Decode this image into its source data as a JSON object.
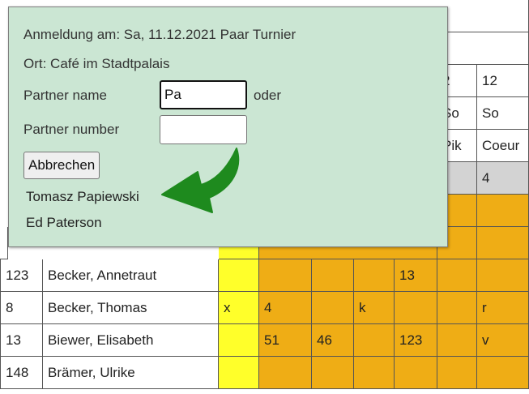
{
  "dialog": {
    "title": "Anmeldung am: Sa, 11.12.2021 Paar Turnier",
    "location": "Ort: Café im Stadtpalais",
    "partner_name_label": "Partner name",
    "partner_name_value": "Pa",
    "or_label": "oder",
    "partner_number_label": "Partner number",
    "partner_number_value": "",
    "cancel_button": "Abbrechen",
    "suggestions": [
      "Tomasz Papiewski",
      "Ed Paterson"
    ]
  },
  "header_fragments": {
    "row1": [
      "2",
      "12"
    ],
    "row2": [
      "So",
      "So"
    ],
    "row3": [
      "Pik",
      "Coeur"
    ],
    "row4": [
      "4"
    ]
  },
  "table_rows": [
    {
      "num": "123",
      "name": "Becker, Annetraut",
      "c1": "",
      "c2": "",
      "c3": "",
      "c4": "",
      "c5": "13",
      "c6": "",
      "c7": ""
    },
    {
      "num": "8",
      "name": "Becker, Thomas",
      "c1": "x",
      "c2": "4",
      "c3": "",
      "c4": "k",
      "c5": "",
      "c6": "",
      "c7": "r"
    },
    {
      "num": "13",
      "name": "Biewer, Elisabeth",
      "c1": "",
      "c2": "51",
      "c3": "46",
      "c4": "",
      "c5": "123",
      "c6": "",
      "c7": "v"
    },
    {
      "num": "148",
      "name": "Brämer, Ulrike",
      "c1": "",
      "c2": "",
      "c3": "",
      "c4": "",
      "c5": "",
      "c6": "",
      "c7": ""
    }
  ],
  "colors": {
    "dialog_bg": "#cbe6d3",
    "orange": "#efad15",
    "yellow": "#ffff2a",
    "grey": "#d3d3d3",
    "arrow": "#1e8a1e"
  },
  "icons": {
    "pointer_arrow": "curved-arrow-icon"
  }
}
